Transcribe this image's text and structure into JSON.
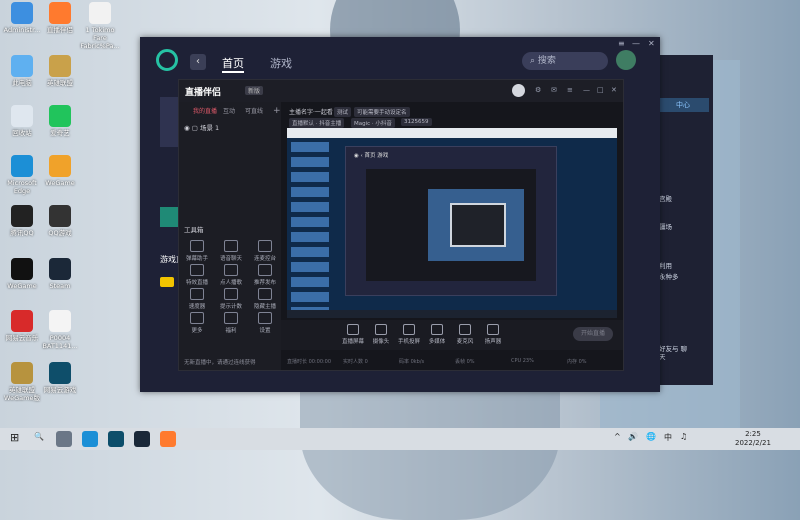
{
  "desktop": {
    "icons": [
      {
        "label": "Administr...",
        "icon": "user-folder-icon",
        "color": "#3d8fe0"
      },
      {
        "label": "直播伴侣",
        "icon": "doc-icon",
        "color": "#ff7a2e"
      },
      {
        "label": "1 Tokimo Fare Fabric%Pa...",
        "icon": "file-icon",
        "color": "#f2f2f2"
      },
      {
        "label": "此电脑",
        "icon": "computer-icon",
        "color": "#5fb0f0"
      },
      {
        "label": "英雄联盟",
        "icon": "game-icon",
        "color": "#c9a14a"
      },
      {
        "label": "回收站",
        "icon": "recycle-bin-icon",
        "color": "#dfe7ef"
      },
      {
        "label": "爱奇艺",
        "icon": "iqiyi-icon",
        "color": "#21c45c"
      },
      {
        "label": "Microsoft Edge",
        "icon": "edge-icon",
        "color": "#1c8fd6"
      },
      {
        "label": "WeGame",
        "icon": "game-icon",
        "color": "#f0a22a"
      },
      {
        "label": "腾讯QQ",
        "icon": "qq-icon",
        "color": "#222"
      },
      {
        "label": "QQ游戏",
        "icon": "qq-game-icon",
        "color": "#333"
      },
      {
        "label": "WeGame",
        "icon": "wegame-icon",
        "color": "#111"
      },
      {
        "label": "Steam",
        "icon": "steam-icon",
        "color": "#1b2838"
      },
      {
        "label": "网易云音乐",
        "icon": "music-icon",
        "color": "#d82a2a"
      },
      {
        "label": "P0004 BAT1141...",
        "icon": "doc-icon",
        "color": "#f4f4f4"
      },
      {
        "label": "英雄联盟 WeGame版",
        "icon": "lol-icon",
        "color": "#b7933e"
      },
      {
        "label": "网易云游戏",
        "icon": "cloud-game-icon",
        "color": "#0e4e6a"
      }
    ]
  },
  "background_window": {
    "tag": "中心",
    "items": [
      "宫殿",
      "疆场",
      "利用",
      "永种多"
    ],
    "bottom_text": "好友与 聊天"
  },
  "app": {
    "nav": {
      "home": "首页",
      "games": "游戏"
    },
    "search_placeholder": "搜索",
    "live_label": "游戏直",
    "window_controls": [
      "≡",
      "—",
      "✕"
    ]
  },
  "inner_app": {
    "title": "直播伴侣",
    "badge": "新版",
    "side_tabs": [
      "我的直播",
      "互动",
      "可直线"
    ],
    "scene_name": "场景 1",
    "tools_title": "工具箱",
    "tools": [
      "弹幕助手",
      "语音聊天",
      "连麦控台",
      "特效直播",
      "点人播歌",
      "推荐发布",
      "速度器",
      "提示计数",
      "隐藏主播",
      "更多",
      "福利",
      "设置"
    ],
    "footer_text": "无新直播中，请通过连线获得",
    "info_line": "主播名字·一起看",
    "chips": [
      "测试",
      "可能需要手动设定名",
      "直播默认 · 抖音主播",
      "Magic · 小抖音",
      "3125659"
    ],
    "controls": [
      "直播屏幕",
      "摄像头",
      "手机投屏",
      "多媒体",
      "麦克风",
      "扬声器"
    ],
    "go_live": "开始直播",
    "status": [
      "直播时长 00:00:00",
      "实时人数 0",
      "码率 0kb/s",
      "丢帧 0%",
      "CPU 23%",
      "内存 0%"
    ]
  },
  "taskbar": {
    "start": "⊞",
    "search": "🔍",
    "tray": [
      "^",
      "🔊",
      "🌐",
      "中",
      "♫"
    ],
    "time": "2:25",
    "date": "2022/2/21"
  }
}
